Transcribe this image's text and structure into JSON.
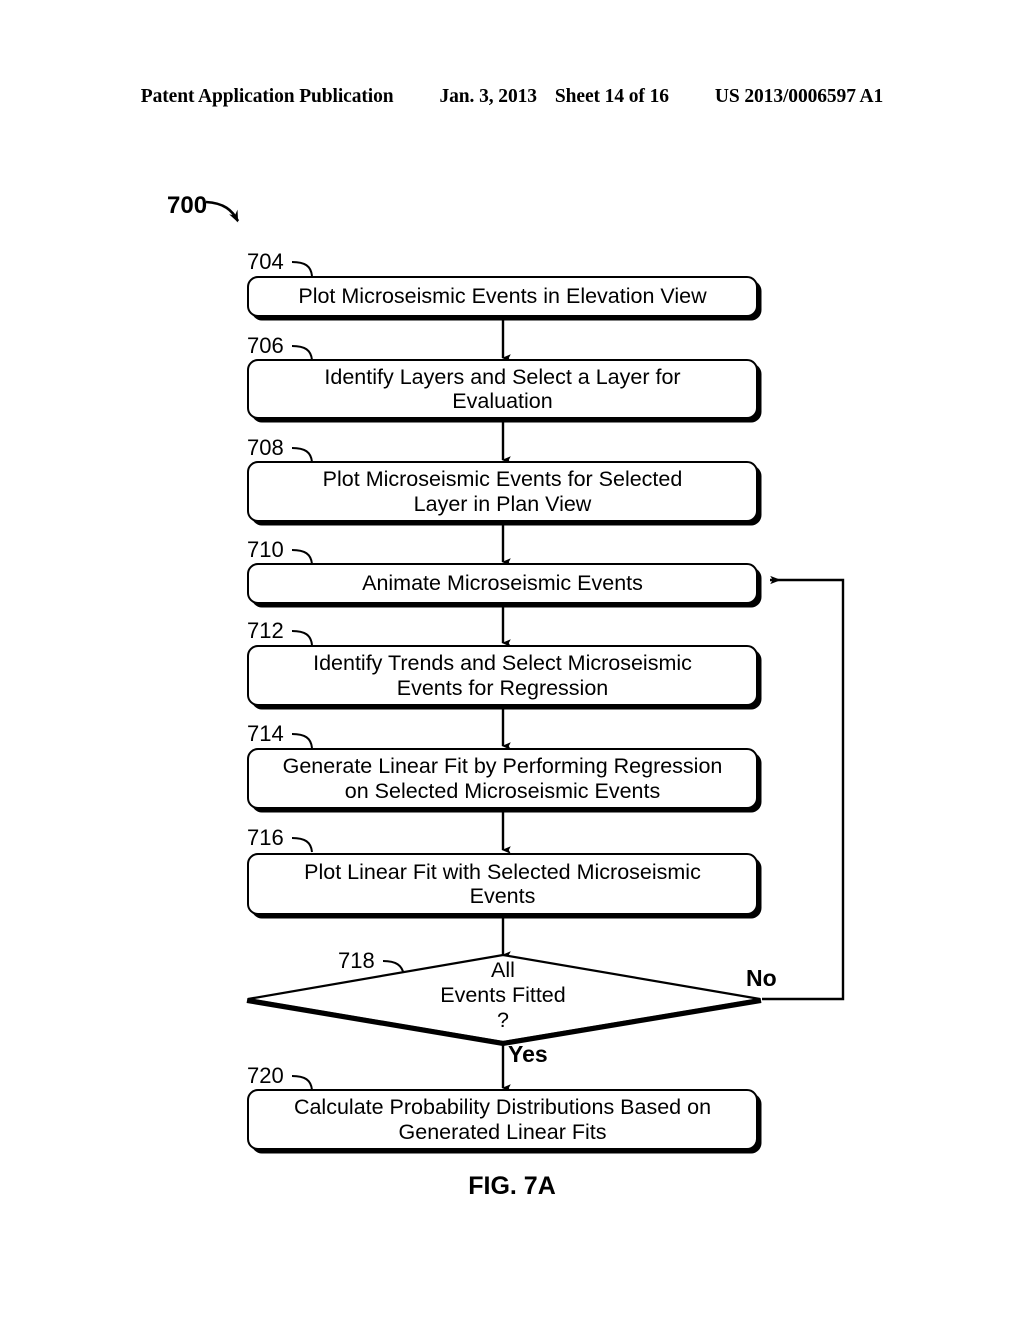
{
  "header": {
    "publication": "Patent Application Publication",
    "date": "Jan. 3, 2013",
    "sheet": "Sheet 14 of 16",
    "document_number": "US 2013/0006597 A1"
  },
  "figure": {
    "caption": "FIG. 7A",
    "flow_id": "700"
  },
  "flowchart": {
    "nodes": [
      {
        "ref": "704",
        "text": "Plot Microseismic Events in Elevation View",
        "shape": "process"
      },
      {
        "ref": "706",
        "text": "Identify Layers and Select a Layer for\nEvaluation",
        "shape": "process"
      },
      {
        "ref": "708",
        "text": "Plot Microseismic Events for Selected\nLayer in Plan View",
        "shape": "process"
      },
      {
        "ref": "710",
        "text": "Animate Microseismic Events",
        "shape": "process"
      },
      {
        "ref": "712",
        "text": "Identify Trends and Select Microseismic\nEvents for Regression",
        "shape": "process"
      },
      {
        "ref": "714",
        "text": "Generate Linear Fit by Performing Regression\non Selected Microseismic Events",
        "shape": "process"
      },
      {
        "ref": "716",
        "text": "Plot Linear Fit with Selected Microseismic\nEvents",
        "shape": "process"
      },
      {
        "ref": "718",
        "text": "All\nEvents Fitted\n?",
        "shape": "decision"
      },
      {
        "ref": "720",
        "text": "Calculate Probability Distributions Based on\nGenerated Linear Fits",
        "shape": "process"
      }
    ],
    "branch_labels": {
      "no": "No",
      "yes": "Yes"
    },
    "edges": [
      {
        "from": "704",
        "to": "706",
        "label": ""
      },
      {
        "from": "706",
        "to": "708",
        "label": ""
      },
      {
        "from": "708",
        "to": "710",
        "label": ""
      },
      {
        "from": "710",
        "to": "712",
        "label": ""
      },
      {
        "from": "712",
        "to": "714",
        "label": ""
      },
      {
        "from": "714",
        "to": "716",
        "label": ""
      },
      {
        "from": "716",
        "to": "718",
        "label": ""
      },
      {
        "from": "718",
        "to": "720",
        "label": "Yes"
      },
      {
        "from": "718",
        "to": "710",
        "label": "No"
      }
    ]
  },
  "colors": {
    "ink": "#000000",
    "paper": "#ffffff"
  }
}
